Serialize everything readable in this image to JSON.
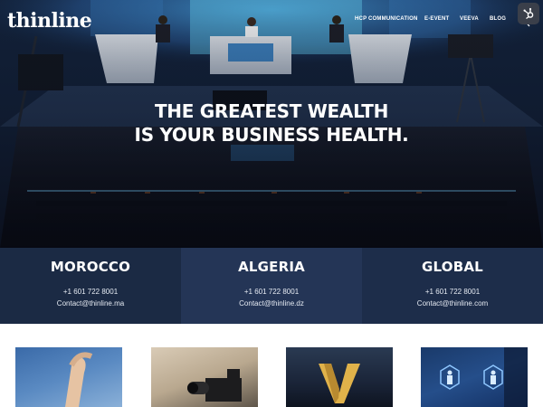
{
  "header": {
    "logo_text": "thinline",
    "nav": [
      {
        "label": "HCP COMMUNICATION"
      },
      {
        "label": "E-EVENT"
      },
      {
        "label": "VEEVA"
      },
      {
        "label": "BLOG"
      }
    ],
    "icons": {
      "search": "search-icon",
      "hubspot": "hubspot-icon"
    }
  },
  "hero": {
    "headline_line1": "THE GREATEST WEALTH",
    "headline_line2": "IS YOUR BUSINESS HEALTH."
  },
  "regions": [
    {
      "name": "MOROCCO",
      "phone": "+1 601 722 8001",
      "email": "Contact@thinline.ma"
    },
    {
      "name": "ALGERIA",
      "phone": "+1 601 722 8001",
      "email": "Contact@thinline.dz"
    },
    {
      "name": "GLOBAL",
      "phone": "+1 601 722 8001",
      "email": "Contact@thinline.com"
    }
  ],
  "colors": {
    "band_left": "#1b2a44",
    "band_center": "#243556",
    "band_right": "#1d2d4a",
    "text_primary": "#ffffff"
  }
}
